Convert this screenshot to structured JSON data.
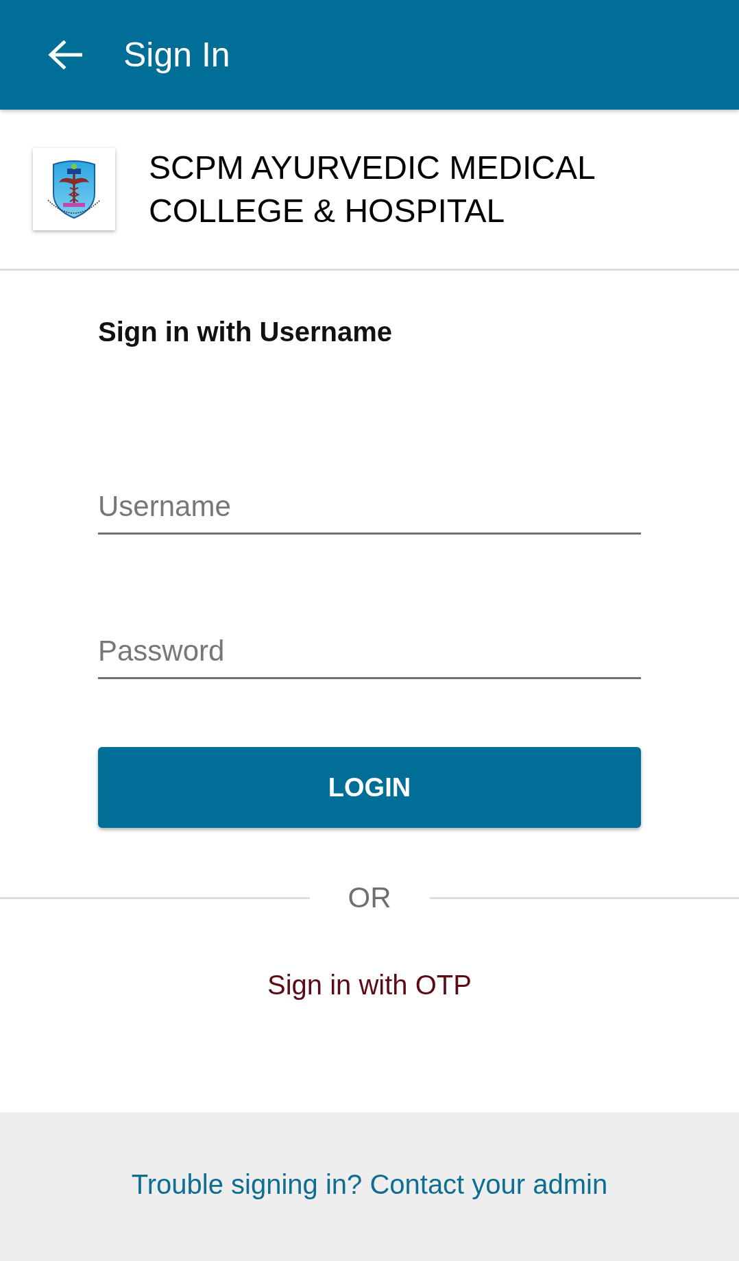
{
  "app_bar": {
    "title": "Sign In"
  },
  "institution": {
    "name": "SCPM AYURVEDIC MEDICAL COLLEGE & HOSPITAL"
  },
  "form": {
    "heading": "Sign in with Username",
    "fields": [
      {
        "placeholder": "Username"
      },
      {
        "placeholder": "Password"
      }
    ],
    "submit": "LOGIN"
  },
  "divider": {
    "label": "OR"
  },
  "otp_link": "Sign in with OTP",
  "footer": {
    "help_link": "Trouble signing in? Contact your admin"
  }
}
